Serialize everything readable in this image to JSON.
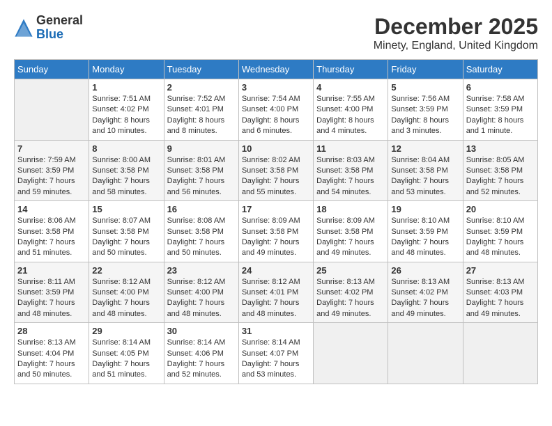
{
  "header": {
    "logo_line1": "General",
    "logo_line2": "Blue",
    "month_title": "December 2025",
    "location": "Minety, England, United Kingdom"
  },
  "weekdays": [
    "Sunday",
    "Monday",
    "Tuesday",
    "Wednesday",
    "Thursday",
    "Friday",
    "Saturday"
  ],
  "weeks": [
    [
      {
        "day": "",
        "info": ""
      },
      {
        "day": "1",
        "info": "Sunrise: 7:51 AM\nSunset: 4:02 PM\nDaylight: 8 hours\nand 10 minutes."
      },
      {
        "day": "2",
        "info": "Sunrise: 7:52 AM\nSunset: 4:01 PM\nDaylight: 8 hours\nand 8 minutes."
      },
      {
        "day": "3",
        "info": "Sunrise: 7:54 AM\nSunset: 4:00 PM\nDaylight: 8 hours\nand 6 minutes."
      },
      {
        "day": "4",
        "info": "Sunrise: 7:55 AM\nSunset: 4:00 PM\nDaylight: 8 hours\nand 4 minutes."
      },
      {
        "day": "5",
        "info": "Sunrise: 7:56 AM\nSunset: 3:59 PM\nDaylight: 8 hours\nand 3 minutes."
      },
      {
        "day": "6",
        "info": "Sunrise: 7:58 AM\nSunset: 3:59 PM\nDaylight: 8 hours\nand 1 minute."
      }
    ],
    [
      {
        "day": "7",
        "info": "Sunrise: 7:59 AM\nSunset: 3:59 PM\nDaylight: 7 hours\nand 59 minutes."
      },
      {
        "day": "8",
        "info": "Sunrise: 8:00 AM\nSunset: 3:58 PM\nDaylight: 7 hours\nand 58 minutes."
      },
      {
        "day": "9",
        "info": "Sunrise: 8:01 AM\nSunset: 3:58 PM\nDaylight: 7 hours\nand 56 minutes."
      },
      {
        "day": "10",
        "info": "Sunrise: 8:02 AM\nSunset: 3:58 PM\nDaylight: 7 hours\nand 55 minutes."
      },
      {
        "day": "11",
        "info": "Sunrise: 8:03 AM\nSunset: 3:58 PM\nDaylight: 7 hours\nand 54 minutes."
      },
      {
        "day": "12",
        "info": "Sunrise: 8:04 AM\nSunset: 3:58 PM\nDaylight: 7 hours\nand 53 minutes."
      },
      {
        "day": "13",
        "info": "Sunrise: 8:05 AM\nSunset: 3:58 PM\nDaylight: 7 hours\nand 52 minutes."
      }
    ],
    [
      {
        "day": "14",
        "info": "Sunrise: 8:06 AM\nSunset: 3:58 PM\nDaylight: 7 hours\nand 51 minutes."
      },
      {
        "day": "15",
        "info": "Sunrise: 8:07 AM\nSunset: 3:58 PM\nDaylight: 7 hours\nand 50 minutes."
      },
      {
        "day": "16",
        "info": "Sunrise: 8:08 AM\nSunset: 3:58 PM\nDaylight: 7 hours\nand 50 minutes."
      },
      {
        "day": "17",
        "info": "Sunrise: 8:09 AM\nSunset: 3:58 PM\nDaylight: 7 hours\nand 49 minutes."
      },
      {
        "day": "18",
        "info": "Sunrise: 8:09 AM\nSunset: 3:58 PM\nDaylight: 7 hours\nand 49 minutes."
      },
      {
        "day": "19",
        "info": "Sunrise: 8:10 AM\nSunset: 3:59 PM\nDaylight: 7 hours\nand 48 minutes."
      },
      {
        "day": "20",
        "info": "Sunrise: 8:10 AM\nSunset: 3:59 PM\nDaylight: 7 hours\nand 48 minutes."
      }
    ],
    [
      {
        "day": "21",
        "info": "Sunrise: 8:11 AM\nSunset: 3:59 PM\nDaylight: 7 hours\nand 48 minutes."
      },
      {
        "day": "22",
        "info": "Sunrise: 8:12 AM\nSunset: 4:00 PM\nDaylight: 7 hours\nand 48 minutes."
      },
      {
        "day": "23",
        "info": "Sunrise: 8:12 AM\nSunset: 4:00 PM\nDaylight: 7 hours\nand 48 minutes."
      },
      {
        "day": "24",
        "info": "Sunrise: 8:12 AM\nSunset: 4:01 PM\nDaylight: 7 hours\nand 48 minutes."
      },
      {
        "day": "25",
        "info": "Sunrise: 8:13 AM\nSunset: 4:02 PM\nDaylight: 7 hours\nand 49 minutes."
      },
      {
        "day": "26",
        "info": "Sunrise: 8:13 AM\nSunset: 4:02 PM\nDaylight: 7 hours\nand 49 minutes."
      },
      {
        "day": "27",
        "info": "Sunrise: 8:13 AM\nSunset: 4:03 PM\nDaylight: 7 hours\nand 49 minutes."
      }
    ],
    [
      {
        "day": "28",
        "info": "Sunrise: 8:13 AM\nSunset: 4:04 PM\nDaylight: 7 hours\nand 50 minutes."
      },
      {
        "day": "29",
        "info": "Sunrise: 8:14 AM\nSunset: 4:05 PM\nDaylight: 7 hours\nand 51 minutes."
      },
      {
        "day": "30",
        "info": "Sunrise: 8:14 AM\nSunset: 4:06 PM\nDaylight: 7 hours\nand 52 minutes."
      },
      {
        "day": "31",
        "info": "Sunrise: 8:14 AM\nSunset: 4:07 PM\nDaylight: 7 hours\nand 53 minutes."
      },
      {
        "day": "",
        "info": ""
      },
      {
        "day": "",
        "info": ""
      },
      {
        "day": "",
        "info": ""
      }
    ]
  ]
}
